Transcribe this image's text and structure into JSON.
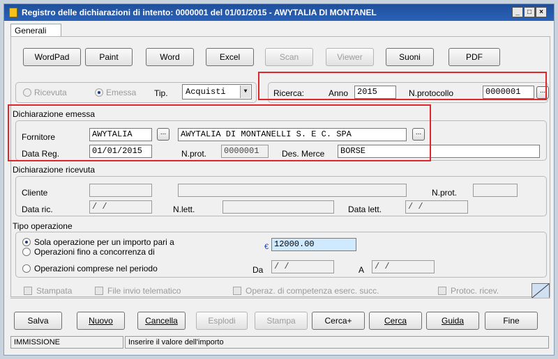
{
  "window": {
    "title": "Registro delle dichiarazioni di intento:  0000001 del 01/01/2015 - AWYTALIA DI MONTANEL"
  },
  "tab": "Generali",
  "toolbar": [
    "WordPad",
    "Paint",
    "Word",
    "Excel",
    "Scan",
    "Viewer",
    "Suoni",
    "PDF"
  ],
  "direction": {
    "ricevuta": "Ricevuta",
    "emessa": "Emessa",
    "tip_label": "Tip.",
    "tip_value": "Acquisti"
  },
  "search": {
    "label": "Ricerca:",
    "anno_label": "Anno",
    "anno_value": "2015",
    "nprot_label": "N.protocollo",
    "nprot_value": "0000001"
  },
  "emessa": {
    "title": "Dichiarazione emessa",
    "fornitore_label": "Fornitore",
    "fornitore_code": "AWYTALIA",
    "fornitore_name": "AWYTALIA DI MONTANELLI S. E C. SPA",
    "datareg_label": "Data Reg.",
    "datareg_value": "01/01/2015",
    "nprot_label": "N.prot.",
    "nprot_value": "0000001",
    "desmerce_label": "Des. Merce",
    "desmerce_value": "BORSE"
  },
  "ricevuta": {
    "title": "Dichiarazione ricevuta",
    "cliente_label": "Cliente",
    "nprot_label": "N.prot.",
    "datarec_label": "Data ric.",
    "datarec_value": " /  /",
    "nlett_label": "N.lett.",
    "datalett_label": "Data lett.",
    "datalett_value": " /  /"
  },
  "tipo": {
    "title": "Tipo operazione",
    "opt1": "Sola operazione per un importo pari a",
    "opt2": "Operazioni fino a concorrenza di",
    "opt3": "Operazioni comprese nel periodo",
    "importo": "12000.00",
    "currency": "€",
    "da_label": "Da",
    "da_value": " /  /",
    "a_label": "A",
    "a_value": " /  /"
  },
  "checks": {
    "stampata": "Stampata",
    "file_invio": "File invio telematico",
    "operaz": "Operaz. di competenza eserc. succ.",
    "protoc": "Protoc. ricev."
  },
  "bottom": [
    "Salva",
    "Nuovo",
    "Cancella",
    "Esplodi",
    "Stampa",
    "Cerca+",
    "Cerca",
    "Guida",
    "Fine"
  ],
  "status": {
    "mode": "IMMISSIONE",
    "message": "Inserire il valore dell'importo"
  },
  "colors": {
    "highlight_box": "#e0262a",
    "titlebar": "#2b62b8",
    "input_highlight": "#cfe9ff"
  }
}
